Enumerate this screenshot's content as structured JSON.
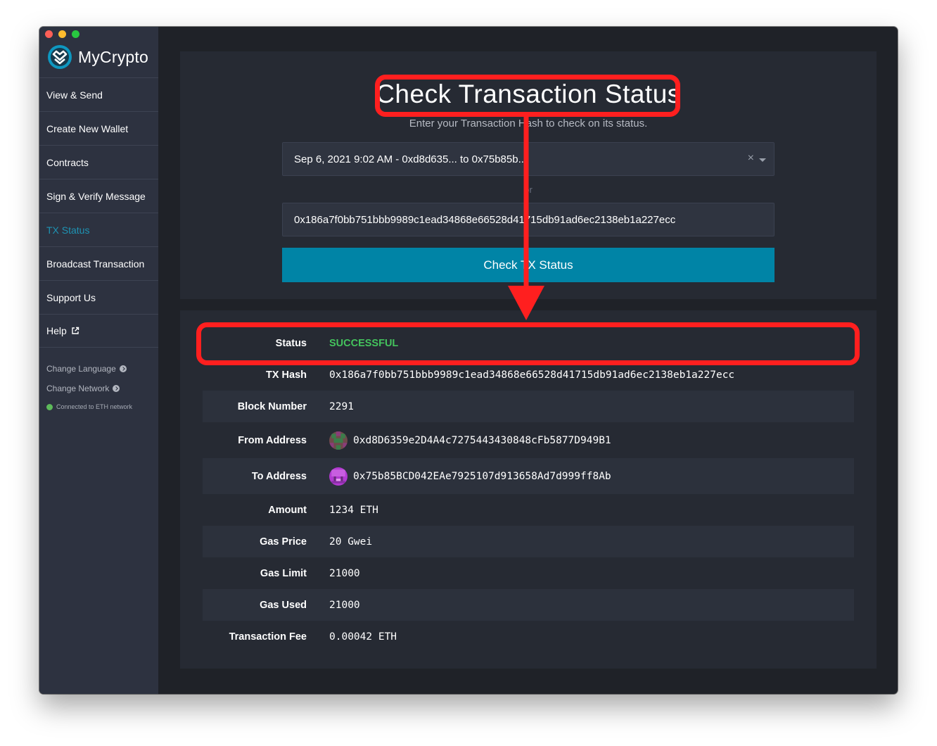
{
  "app": {
    "name": "MyCrypto"
  },
  "sidebar": {
    "items": [
      {
        "label": "View & Send",
        "active": false
      },
      {
        "label": "Create New Wallet",
        "active": false
      },
      {
        "label": "Contracts",
        "active": false
      },
      {
        "label": "Sign & Verify Message",
        "active": false
      },
      {
        "label": "TX Status",
        "active": true
      },
      {
        "label": "Broadcast Transaction",
        "active": false
      },
      {
        "label": "Support Us",
        "active": false
      },
      {
        "label": "Help",
        "active": false,
        "icon": "external-link-icon"
      }
    ],
    "change_language": "Change Language",
    "change_network": "Change Network",
    "connection_status": "Connected to ETH network"
  },
  "main": {
    "title": "Check Transaction Status",
    "subtitle": "Enter your Transaction Hash to check on its status.",
    "recent_select_value": "Sep 6, 2021 9:02 AM - 0xd8d635... to 0x75b85b...",
    "or_text": "or",
    "hash_input_value": "0x186a7f0bb751bbb9989c1ead34868e66528d41715db91ad6ec2138eb1a227ecc",
    "check_button_label": "Check TX Status"
  },
  "result": {
    "status_label": "Status",
    "status_value": "SUCCESSFUL",
    "txhash_label": "TX Hash",
    "txhash_value": "0x186a7f0bb751bbb9989c1ead34868e66528d41715db91ad6ec2138eb1a227ecc",
    "block_label": "Block Number",
    "block_value": "2291",
    "from_label": "From Address",
    "from_value": "0xd8D6359e2D4A4c7275443430848cFb5877D949B1",
    "to_label": "To Address",
    "to_value": "0x75b85BCD042EAe7925107d913658Ad7d999ff8Ab",
    "amount_label": "Amount",
    "amount_value": "1234 ETH",
    "gas_price_label": "Gas Price",
    "gas_price_value": "20 Gwei",
    "gas_limit_label": "Gas Limit",
    "gas_limit_value": "21000",
    "gas_used_label": "Gas Used",
    "gas_used_value": "21000",
    "fee_label": "Transaction Fee",
    "fee_value": "0.00042 ETH"
  },
  "colors": {
    "accent": "#0084a6",
    "success": "#44c35d",
    "annotation": "#ff1f1f",
    "sidebar_bg": "#2d3240"
  }
}
